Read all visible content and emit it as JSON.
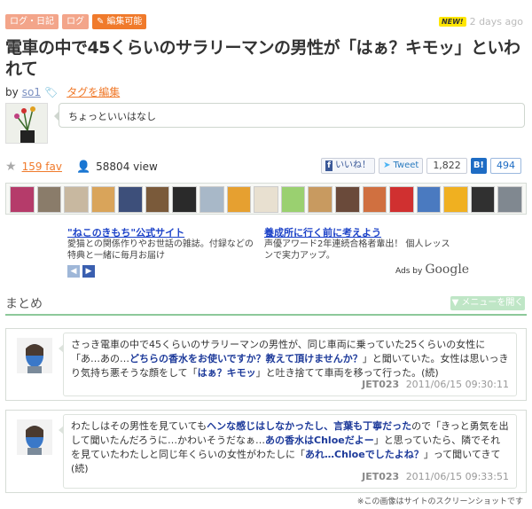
{
  "header": {
    "tags": [
      "ログ・日記",
      "ログ"
    ],
    "edit_tag": "編集可能",
    "new_badge": "NEW!",
    "time_ago": "2 days ago"
  },
  "title": "電車の中で45くらいのサラリーマンの男性が「はぁ？キモッ」といわれて",
  "byline": {
    "by": "by",
    "user": "so1",
    "edit_tags": "タグを編集"
  },
  "description": "ちょっといいはなし",
  "stats": {
    "fav": "159 fav",
    "views": "58804 view"
  },
  "social": {
    "fb_icon": "f",
    "like_label": "いいね！",
    "tweet_label": "Tweet",
    "tweet_count": "1,822",
    "hatena_icon": "B!",
    "hatena_count": "494"
  },
  "avatar_colors": [
    "#b53b6a",
    "#8a7c6a",
    "#c8b8a0",
    "#d9a45a",
    "#3d4f7a",
    "#7a5a3a",
    "#2a2a2a",
    "#a8b8c8",
    "#e6a030",
    "#e8e0d0",
    "#9ad070",
    "#c89a60",
    "#6a4a3a",
    "#d07040",
    "#d03030",
    "#4a7ac0",
    "#f0b020",
    "#303030",
    "#808890"
  ],
  "ads": [
    {
      "title": "\"ねこのきもち\"公式サイト",
      "text": "愛猫との関係作りやお世話の雑誌。付録などの特典と一緒に毎月お届け"
    },
    {
      "title": "養成所に行く前に考えよう",
      "text": "声優アワード2年連続合格者輩出！ 個人レッスンで実力アップ。"
    }
  ],
  "ads_by": "Ads by",
  "google": "Google",
  "section": {
    "title": "まとめ",
    "menu_button": "▼ メニューを開く"
  },
  "entries": [
    {
      "p1": "さっき電車の中で45くらいのサラリーマンの男性が、同じ車両に乗っていた25くらいの女性に「あ…あの…",
      "h1": "どちらの香水をお使いですか？教えて頂けませんか？",
      "p2": "」と聞いていた。女性は思いっきり気持ち悪そうな顔をして「",
      "h2": "はぁ？キモッ",
      "p3": "」と吐き捨てて車両を移って行った。(続)",
      "user": "JET023",
      "date": "2011/06/15 09:30:11"
    },
    {
      "p1": "わたしはその男性を見ていても",
      "h1": "ヘンな感じはしなかったし、言葉も丁寧だった",
      "p2": "ので「きっと勇気を出して聞いたんだろうに…かわいそうだなぁ…",
      "h2": "あの香水はChloeだよー",
      "p3": "」と思っていたら、隣でそれを見ていたわたしと同じ年くらいの女性がわたしに「",
      "h3": "あれ…Chloeでしたよね？",
      "p4": "」って聞いてきて(続)",
      "user": "JET023",
      "date": "2011/06/15 09:33:51"
    }
  ],
  "footnote": "※この画像はサイトのスクリーンショットです"
}
